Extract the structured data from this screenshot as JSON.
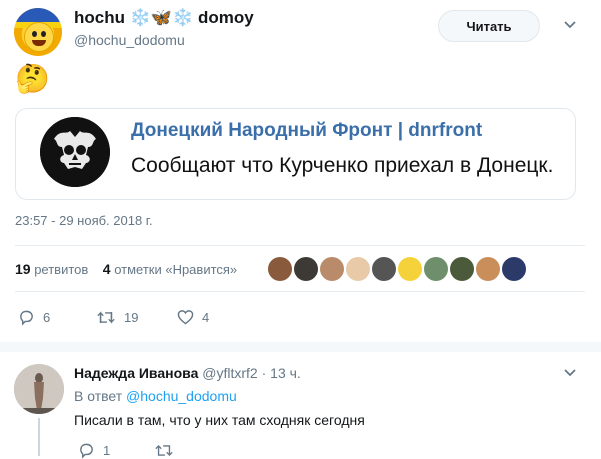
{
  "tweet": {
    "display_name": "hochu",
    "name_emoji_1": "❄️",
    "name_emoji_2": "🦋",
    "name_emoji_3": "❄️",
    "display_name_suffix": "domoy",
    "handle": "@hochu_dodomu",
    "follow_label": "Читать",
    "body_emoji": "🤔",
    "card": {
      "title": "Донецкий Народный Фронт | dnrfront",
      "text": "Сообщают что Курченко приехал в Донецк."
    },
    "timestamp": "23:57 - 29 нояб. 2018 г.",
    "retweets_count": "19",
    "retweets_label": "ретвитов",
    "likes_count": "4",
    "likes_label": "отметки «Нравится»",
    "actions": {
      "replies": "6",
      "retweets": "19",
      "likes": "4"
    }
  },
  "likers": [
    {
      "color": "#8a5a3c"
    },
    {
      "color": "#3d3a36"
    },
    {
      "color": "#b98b6a"
    },
    {
      "color": "#e8c9a8"
    },
    {
      "color": "#555555"
    },
    {
      "color": "#f6d23a"
    },
    {
      "color": "#6f8f6c"
    },
    {
      "color": "#4b5a3a"
    },
    {
      "color": "#c98e5a"
    },
    {
      "color": "#2c3a6a"
    }
  ],
  "reply": {
    "name": "Надежда Иванова",
    "handle": "@yfltxrf2",
    "separator": "·",
    "time": "13 ч.",
    "in_reply_prefix": "В ответ",
    "in_reply_mention": "@hochu_dodomu",
    "text": "Писали в там, что у них там сходняк сегодня",
    "replies": "1"
  },
  "colors": {
    "link": "#1da1f2",
    "card_title": "#3b6fa9",
    "muted": "#657786"
  }
}
